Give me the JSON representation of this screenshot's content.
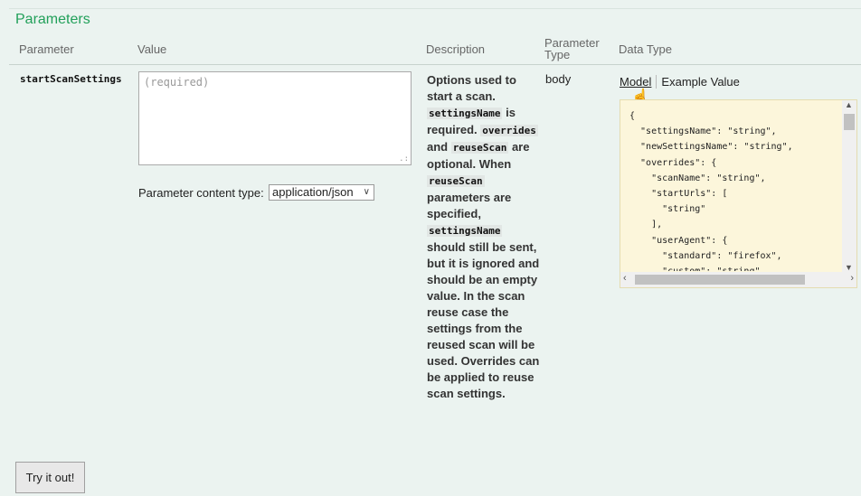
{
  "section_title": "Parameters",
  "headers": {
    "parameter": "Parameter",
    "value": "Value",
    "description": "Description",
    "parameter_type_1": "Parameter",
    "parameter_type_2": "Type",
    "data_type": "Data Type"
  },
  "row": {
    "name": "startScanSettings",
    "value_placeholder": "(required)",
    "content_type_label": "Parameter content type:",
    "content_type_selected": "application/json",
    "description": {
      "t1": "Options used to start a scan. ",
      "c1": "settingsName",
      "t2": " is required. ",
      "c2": "overrides",
      "t3": " and ",
      "c3": "reuseScan",
      "t4": " are optional. When ",
      "c4": "reuseScan",
      "t5": " parameters are specified, ",
      "c5": "settingsName",
      "t6": " should still be sent, but it is ignored and should be an empty value. In the scan reuse case the settings from the reused scan will be used. Overrides can be applied to reuse scan settings."
    },
    "parameter_type": "body",
    "tabs": {
      "model": "Model",
      "example": "Example Value"
    },
    "model_json": "{\n  \"settingsName\": \"string\",\n  \"newSettingsName\": \"string\",\n  \"overrides\": {\n    \"scanName\": \"string\",\n    \"startUrls\": [\n      \"string\"\n    ],\n    \"userAgent\": {\n      \"standard\": \"firefox\",\n      \"custom\": \"string\""
  },
  "try_button": "Try it out!",
  "icons": {
    "cursor": "hand-pointer-icon",
    "select": "chevron-down-icon",
    "resize": "resize-grip-icon"
  }
}
